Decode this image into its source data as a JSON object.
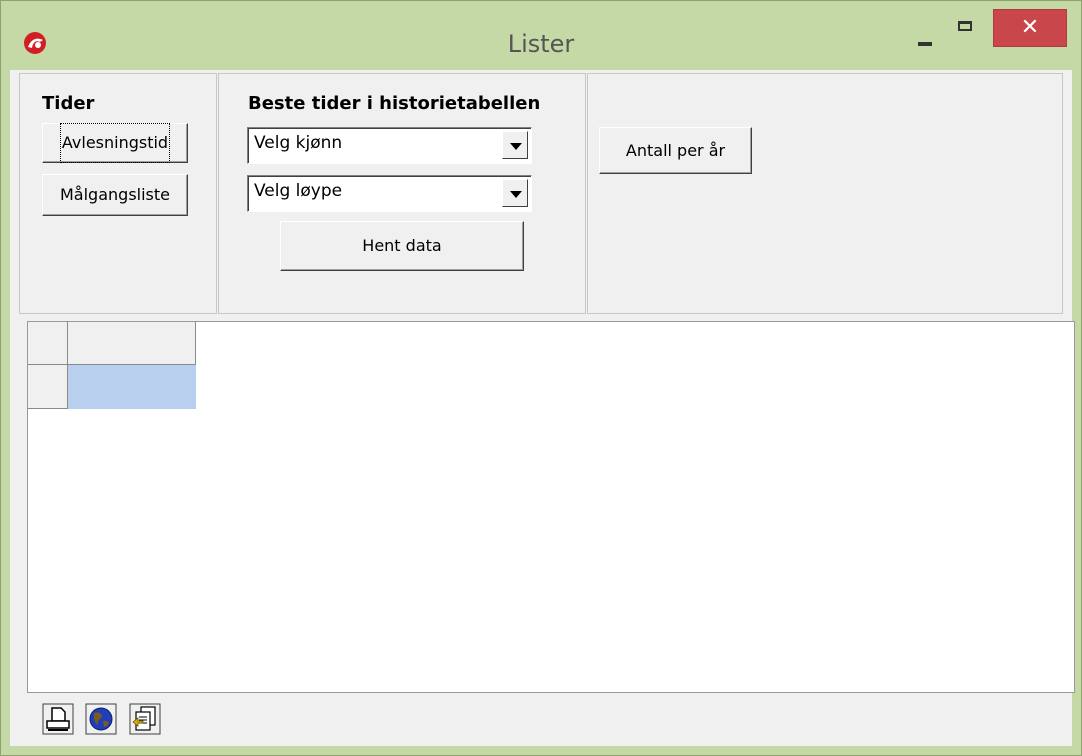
{
  "window": {
    "title": "Lister",
    "close_glyph": "✕"
  },
  "panels": {
    "tider": {
      "heading": "Tider",
      "buttons": [
        "Avlesningstid",
        "Målgangsliste"
      ]
    },
    "beste": {
      "heading": "Beste tider i  historietabellen",
      "gender_select": "Velg kjønn",
      "course_select": "Velg løype",
      "fetch_button": "Hent data"
    },
    "antall": {
      "button": "Antall per år"
    }
  },
  "grid": {
    "selected_cell_color": "#b8cfee"
  },
  "toolbar": {
    "icons": [
      "printer-icon",
      "globe-icon",
      "export-document-icon"
    ]
  },
  "colors": {
    "titlebar": "#c4d9a6",
    "close_button": "#c9464a",
    "app_icon": "#d21f26"
  }
}
